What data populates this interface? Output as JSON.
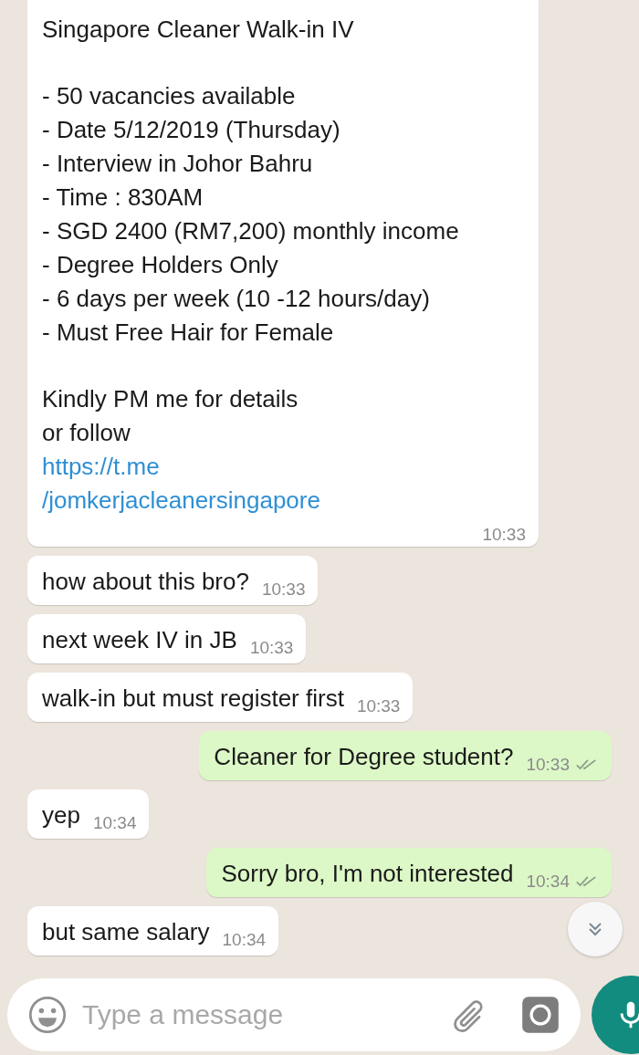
{
  "messages": [
    {
      "outgoing": false,
      "kind": "post",
      "paragraphs": [
        {
          "lines": [
            "Singapore Cleaner Walk-in IV"
          ]
        },
        {
          "lines": [
            "- 50 vacancies available",
            "- Date 5/12/2019 (Thursday)",
            "- Interview in Johor Bahru",
            "- Time : 830AM",
            "- SGD 2400 (RM7,200) monthly income",
            "- Degree Holders Only",
            "- 6 days per week (10 -12 hours/day)",
            "- Must Free Hair for Female"
          ]
        },
        {
          "lines": [
            "Kindly PM me for details",
            "or follow"
          ],
          "link": "https://t.me\n/jomkerjacleanersingapore"
        }
      ],
      "time": "10:33"
    },
    {
      "outgoing": false,
      "kind": "text",
      "text": "how about this bro?",
      "time": "10:33"
    },
    {
      "outgoing": false,
      "kind": "text",
      "text": "next week IV in JB",
      "time": "10:33"
    },
    {
      "outgoing": false,
      "kind": "text",
      "text": "walk-in but must register first",
      "time": "10:33"
    },
    {
      "outgoing": true,
      "kind": "text",
      "text": "Cleaner for Degree student?",
      "time": "10:33",
      "read": false
    },
    {
      "outgoing": false,
      "kind": "text",
      "text": "yep",
      "time": "10:34"
    },
    {
      "outgoing": true,
      "kind": "text",
      "text": "Sorry bro, I'm not interested",
      "time": "10:34",
      "read": false
    },
    {
      "outgoing": false,
      "kind": "text",
      "text": "but same salary",
      "time": "10:34"
    }
  ],
  "composer": {
    "placeholder": "Type a message"
  }
}
